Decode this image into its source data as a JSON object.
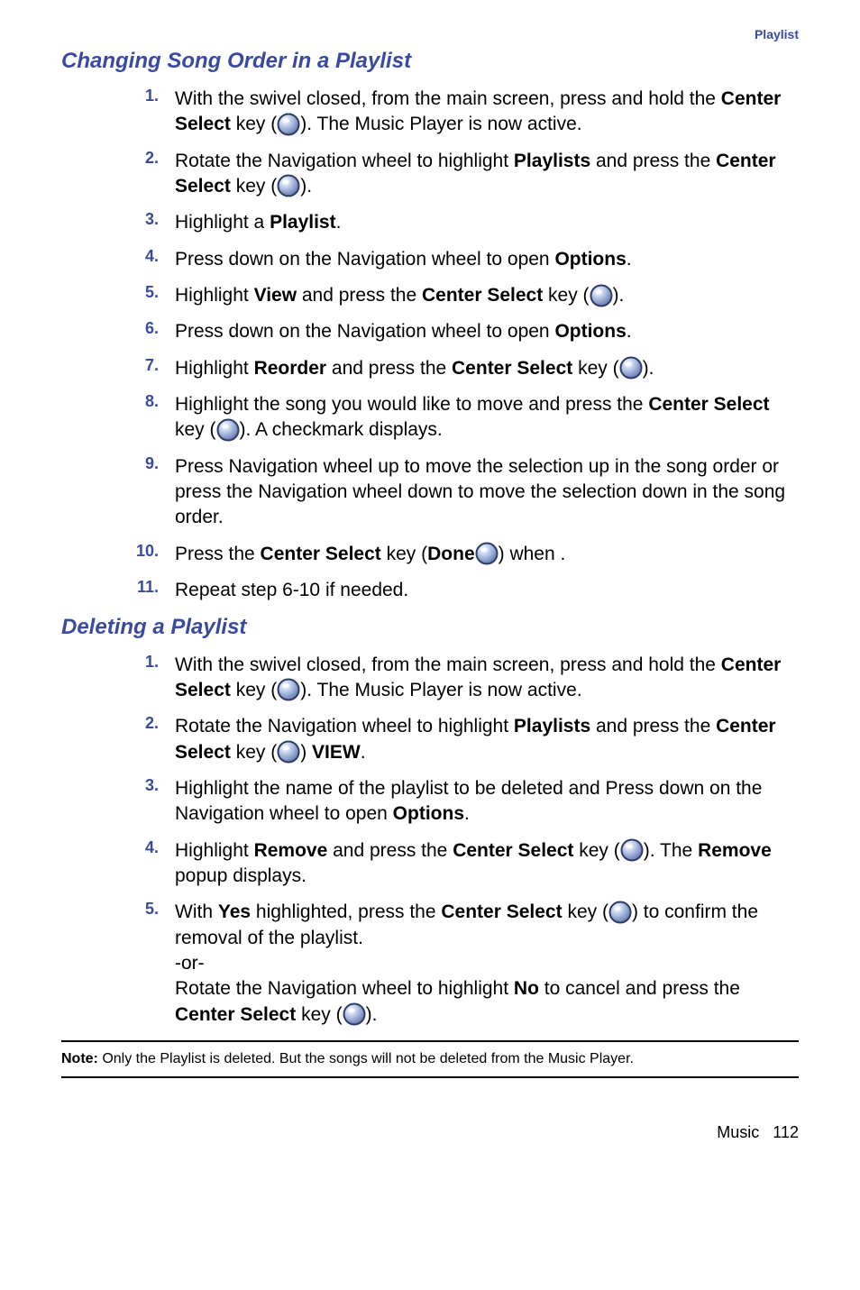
{
  "header": {
    "category": "Playlist"
  },
  "section1": {
    "title": "Changing Song Order in a Playlist",
    "steps": [
      {
        "num": "1.",
        "pre": "With the swivel closed, from the main screen, press and hold the ",
        "b1": "Center Select",
        "mid1": " key (",
        "icon": true,
        "post1": "). The Music Player is now active."
      },
      {
        "num": "2.",
        "pre": "Rotate the Navigation wheel to highlight ",
        "b1": "Playlists",
        "mid1": " and press the ",
        "b2": "Center Select",
        "mid2": " key (",
        "icon": true,
        "post1": ")."
      },
      {
        "num": "3.",
        "pre": "Highlight a ",
        "b1": "Playlist",
        "post1": "."
      },
      {
        "num": "4.",
        "pre": "Press down on the Navigation wheel to open ",
        "b1": "Options",
        "post1": "."
      },
      {
        "num": "5.",
        "pre": "Highlight ",
        "b1": "View",
        "mid1": " and press the ",
        "b2": "Center Select",
        "mid2": " key (",
        "icon": true,
        "post1": ")."
      },
      {
        "num": "6.",
        "pre": "Press down on the Navigation wheel to open ",
        "b1": "Options",
        "post1": "."
      },
      {
        "num": "7.",
        "pre": "Highlight ",
        "b1": "Reorder",
        "mid1": " and press the ",
        "b2": "Center Select",
        "mid2": " key (",
        "icon": true,
        "post1": ")."
      },
      {
        "num": "8.",
        "pre": "Highlight the song you would like to move and press the ",
        "b1": "Center Select",
        "mid1": " key (",
        "icon": true,
        "post1": "). A checkmark displays."
      },
      {
        "num": "9.",
        "plain": "Press Navigation wheel up to move the selection up in the song order or press the Navigation wheel down to move the selection down in the song order."
      },
      {
        "num": "10.",
        "pre": "Press the ",
        "b1": "Center Select",
        "mid1": " key (",
        "icon": true,
        "post1": ") when ",
        "b2": "Done",
        "post2": "."
      },
      {
        "num": "11.",
        "plain": "Repeat step 6-10 if needed."
      }
    ]
  },
  "section2": {
    "title": "Deleting a Playlist",
    "steps": [
      {
        "num": "1.",
        "pre": "With the swivel closed, from the main screen, press and hold the ",
        "b1": "Center Select",
        "mid1": " key (",
        "icon": true,
        "post1": "). The Music Player is now active."
      },
      {
        "num": "2.",
        "pre": "Rotate the Navigation wheel to highlight ",
        "b1": "Playlists",
        "mid1": " and press the ",
        "b2": "Center Select",
        "mid2": " key (",
        "icon": true,
        "post1": ") ",
        "b3": "VIEW",
        "post2": "."
      },
      {
        "num": "3.",
        "pre": "Highlight the name of the playlist to be deleted and Press down on the Navigation wheel to open ",
        "b1": "Options",
        "post1": "."
      },
      {
        "num": "4.",
        "pre": "Highlight ",
        "b1": "Remove",
        "mid1": " and press the ",
        "b2": "Center Select",
        "mid2": " key (",
        "icon": true,
        "post1": "). The ",
        "b3": "Remove",
        "post2": " popup displays."
      },
      {
        "num": "5.",
        "pre": "With ",
        "b1": "Yes",
        "mid1": " highlighted, press the ",
        "b2": "Center Select",
        "mid2": " key (",
        "icon": true,
        "post1": ") to confirm the removal of the playlist.",
        "tail_or": "-or-",
        "tail": "Rotate the Navigation wheel to highlight ",
        "tb1": "No",
        "tmid": " to cancel and press the ",
        "tb2": "Center Select",
        "tmid2": " key (",
        "ticon": true,
        "tpost": ")."
      }
    ]
  },
  "note": {
    "label": "Note:",
    "text": " Only the Playlist is deleted.  But the songs will not be deleted from the Music Player."
  },
  "footer": {
    "chapter": "Music",
    "page": "112"
  }
}
